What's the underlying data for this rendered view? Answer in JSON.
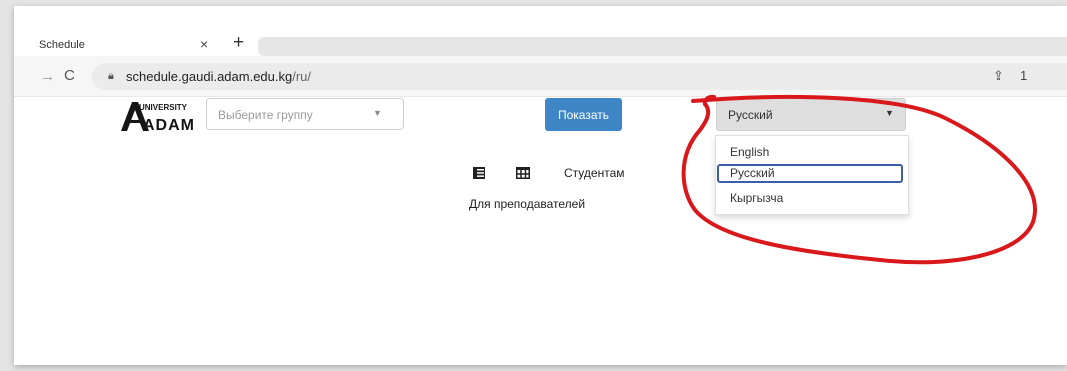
{
  "browser": {
    "tab_title": "Schedule",
    "tab_close": "×",
    "new_tab": "+",
    "forward": "→",
    "reload": "C",
    "url_host": "schedule.gaudi.adam.edu.kg",
    "url_path": "/ru/",
    "share_more": "1"
  },
  "logo": {
    "top": "UNIVERSITY",
    "word": "ADAM"
  },
  "page": {
    "group_placeholder": "Выберите группу",
    "show_button": "Показать",
    "language_selected": "Русский",
    "language_options": [
      "English",
      "Русский",
      "Кыргызча"
    ],
    "students_label": "Студентам",
    "teachers_label": "Для преподавателей"
  },
  "colors": {
    "accent_button": "#3e86c6",
    "annotation_stroke": "#d8181b",
    "selected_outline": "#3b5ea8"
  }
}
